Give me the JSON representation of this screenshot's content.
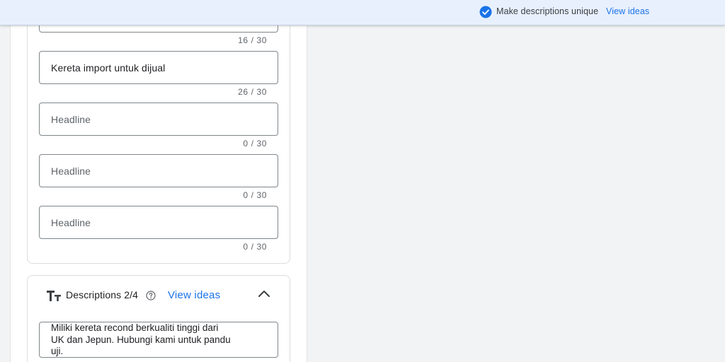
{
  "banner": {
    "unique_text": "Make descriptions unique",
    "view_ideas": "View ideas",
    "check_icon": "check-circle-icon",
    "accent": "#1a73e8"
  },
  "headlines": [
    {
      "value": "",
      "counter": "16 / 30"
    },
    {
      "value": "Kereta import untuk dijual",
      "counter": "26 / 30"
    },
    {
      "placeholder": "Headline",
      "counter": "0 / 30"
    },
    {
      "placeholder": "Headline",
      "counter": "0 / 30"
    },
    {
      "placeholder": "Headline",
      "counter": "0 / 30"
    }
  ],
  "descriptions": {
    "title": "Descriptions 2/4",
    "view_ideas": "View ideas",
    "help_icon": "help-circle-icon",
    "collapse_icon": "chevron-up-icon",
    "first_value_lines": [
      "Miliki kereta recond berkualiti tinggi dari",
      "UK dan Jepun. Hubungi kami untuk pandu",
      "uji."
    ]
  }
}
